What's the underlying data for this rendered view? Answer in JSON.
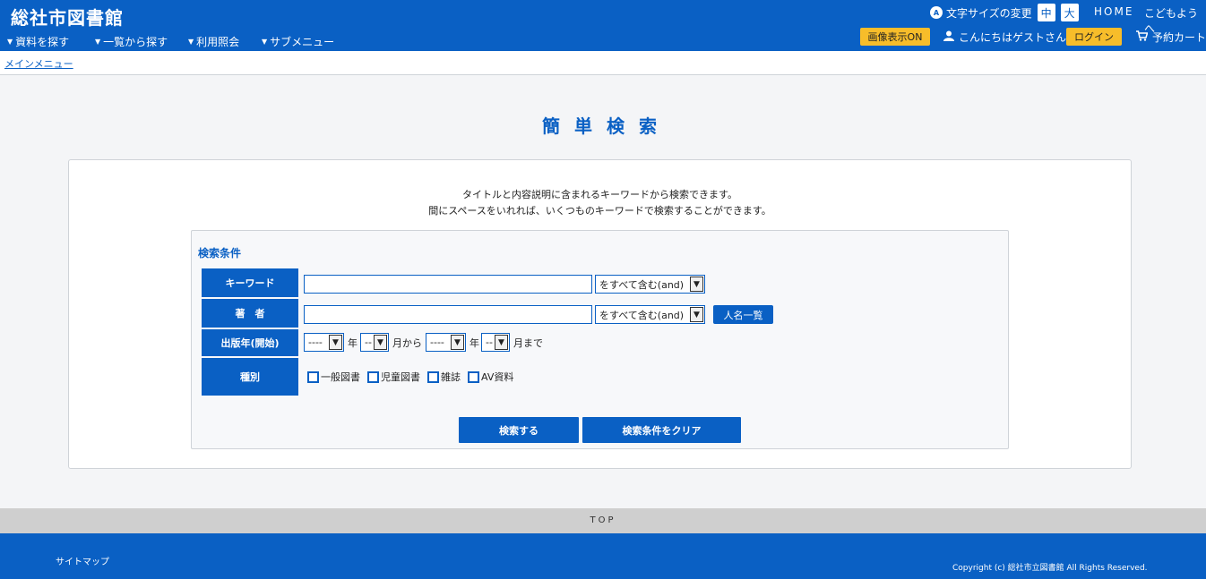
{
  "header": {
    "site_title": "総社市図書館",
    "nav": [
      "資料を探す",
      "一覧から探す",
      "利用照会",
      "サブメニュー"
    ],
    "font_size_label": "文字サイズの変更",
    "font_size_medium": "中",
    "font_size_large": "大",
    "home": "HOME",
    "kids": "こどもようへ",
    "image_toggle": "画像表示ON",
    "greeting": "こんにちはゲストさん",
    "login": "ログイン",
    "cart": "予約カート",
    "accent_color": "#0a60c4",
    "button_color": "#f7bd2a"
  },
  "breadcrumb": {
    "main_menu": "メインメニュー"
  },
  "page": {
    "title": "簡単検索",
    "desc_line1": "タイトルと内容説明に含まれるキーワードから検索できます。",
    "desc_line2": "間にスペースをいれれば、いくつものキーワードで検索することができます。"
  },
  "form": {
    "section_title": "検索条件",
    "keyword_label": "キーワード",
    "author_label": "著　者",
    "year_label": "出版年(開始)",
    "type_label": "種別",
    "keyword_value": "",
    "author_value": "",
    "match_mode_keyword": "をすべて含む(and)",
    "match_mode_author": "をすべて含む(and)",
    "person_list_button": "人名一覧",
    "year_from": "----",
    "month_from": "--",
    "year_to": "----",
    "month_to": "--",
    "nen": "年",
    "tsuki_kara": "月から",
    "tsuki_made": "月まで",
    "types": [
      "一般図書",
      "児童図書",
      "雑誌",
      "AV資料"
    ],
    "search_button": "検索する",
    "clear_button": "検索条件をクリア"
  },
  "footer": {
    "top": "TOP",
    "sitemap": "サイトマップ",
    "copyright": "Copyright (c) 総社市立図書館 All Rights Reserved."
  }
}
